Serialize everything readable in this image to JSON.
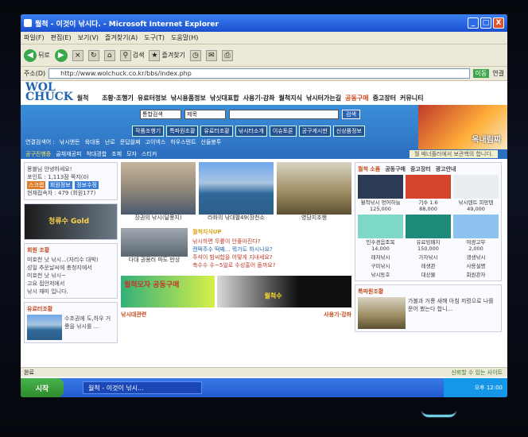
{
  "window": {
    "title": "월척 - 이것이 낚시다. - Microsoft Internet Explorer",
    "min": "_",
    "max": "□",
    "close": "X"
  },
  "menu": [
    "파일(F)",
    "편집(E)",
    "보기(V)",
    "즐겨찾기(A)",
    "도구(T)",
    "도움말(H)"
  ],
  "toolbar": {
    "back": "뒤로",
    "search": "검색",
    "favorites": "즐겨찾기"
  },
  "address": {
    "label": "주소(D)",
    "url": "http://www.wolchuck.co.kr/bbs/index.php",
    "go": "이동",
    "links": "연결"
  },
  "site": {
    "logo_top": "WOL",
    "logo_bottom": "CHUCK",
    "logo_kr": "월척",
    "nav": [
      "조황·조행기",
      "유료터정보",
      "낚시용품정보",
      "낚싯대표합",
      "사용기·강좌",
      "월척지식",
      "낚시터가는길",
      "공동구매",
      "중고장터",
      "커뮤니티"
    ],
    "nav_highlight_index": 7,
    "search": {
      "scope": "통합검색",
      "field": "제목",
      "button": "검색"
    },
    "quick": [
      "작품조행기",
      "특파원조황",
      "유료터조황",
      "낚시터소개",
      "이슈토론",
      "공구게시판",
      "신상품정보"
    ],
    "links_label": "연결검색어 :",
    "links": [
      "낚시앤돈",
      "육대동",
      "난로",
      "문답쓸쪄",
      "고이넥스",
      "하우스텐트",
      "산들봉투"
    ],
    "banner": "옥내림찌"
  },
  "subbar": {
    "items": [
      "공구진행중",
      "골채재공피",
      "착대경합",
      "조제",
      "모자",
      "스티커"
    ],
    "notice": "월 배너플러에서 보관핵의 합니다."
  },
  "login": {
    "greeting": "몽블님 안녕하세요!",
    "points": "포인트 : 1,113점 쪽지(0)",
    "buttons": [
      "스크랩",
      "회원정보",
      "정보수정"
    ],
    "online": "현재접속자 : 479 (회원177)"
  },
  "left_ad": "청류수 Gold",
  "left_list": {
    "title": "회원 조황",
    "items": [
      "미호천 낫 낚시...(자리수 대박)",
      "성일 추운날씨에 충청지에서",
      "미호천 낫 낚시~",
      "고요 접안저에서",
      "낚시 재미 입니다."
    ]
  },
  "left_photo": {
    "title": "유료터조황",
    "text": "수초권에 도,하우 거룡을 낚시를 ..."
  },
  "photos": [
    {
      "caption": "장권의 낚시(달풍지)"
    },
    {
      "caption": "라화의 낚대펼49(장천소"
    },
    {
      "caption": "영담지조행"
    }
  ],
  "mid_news": {
    "photo_caption": "다대 권용러 파도 만상",
    "title": "월척지식UP",
    "items": [
      "낚시하면 무릎이 안좋아진다?",
      "캔떡주수 떡째... 뭐가도 하시나요?",
      "주석이 밤씨합을 어떻게 지내세요?",
      "촉수수 수~5일로 수성홍어 돌까요?"
    ]
  },
  "ad": {
    "left": "월척모자 공동구매",
    "right": "월척수"
  },
  "mid_footer": {
    "left": "낚시대관련",
    "right": "사용기·강좌"
  },
  "right_shop": {
    "tabs": [
      "월척 소품",
      "공동구매",
      "중고장터",
      "광고안내"
    ],
    "top_items": [
      {
        "label": "월척낚시 엉어하늘",
        "price": "125,000"
      },
      {
        "label": "기수 1.6",
        "price": "88,000"
      },
      {
        "label": "낚시텐트 희망텐",
        "price": "49,000"
      }
    ],
    "bottom_items": [
      {
        "label": "민수경음조복",
        "price": "14,000"
      },
      {
        "label": "유료잉패지",
        "price": "150,000"
      },
      {
        "label": "야광고무",
        "price": "2,000"
      }
    ],
    "categories": [
      "레저낚시",
      "가자낚시",
      "갱생낚시",
      "구미낚시",
      "레생관",
      "사용설명",
      "낚시동호",
      "대상물",
      "회원관자"
    ]
  },
  "right_photo": {
    "title": "특파원조황",
    "text": "가볼과 거룡 새해 아침 저렁으로 나를 문어 봤는다 합니..."
  },
  "status": {
    "left": "완료",
    "zone": "신뢰할 수 있는 사이트"
  },
  "taskbar": {
    "start": "시작",
    "task": "월척 - 이것이 낚시...",
    "clock": "오후 12:00"
  }
}
